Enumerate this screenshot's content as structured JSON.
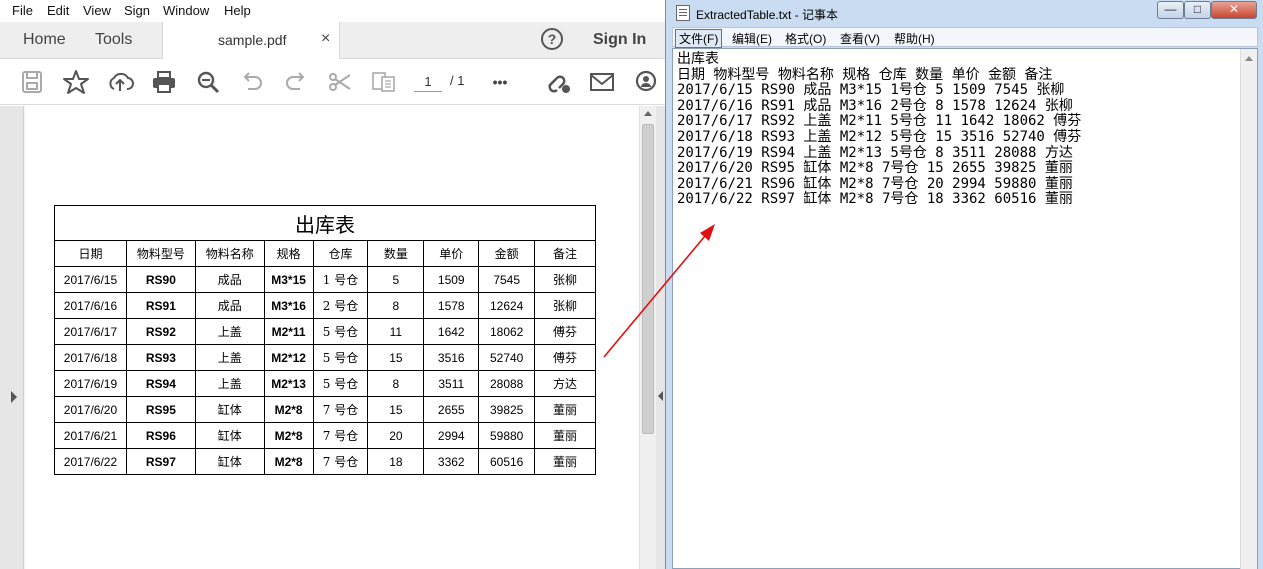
{
  "reader": {
    "menu": [
      "File",
      "Edit",
      "View",
      "Sign",
      "Window",
      "Help"
    ],
    "tabs": {
      "home": "Home",
      "tools": "Tools",
      "document": "sample.pdf",
      "close": "×"
    },
    "help": "?",
    "sign_in": "Sign In",
    "toolbar": {
      "icons": [
        "save-icon",
        "star-icon",
        "upload-icon",
        "print-icon",
        "zoom-icon",
        "undo-icon",
        "redo-icon",
        "scissors-icon",
        "compare-icon",
        "more-icon",
        "link-share-icon",
        "mail-icon",
        "add-user-icon"
      ],
      "page_current": "1",
      "page_total": "/ 1",
      "more": "•••"
    }
  },
  "pdf_table": {
    "title": "出库表",
    "headers": [
      "日期",
      "物料型号",
      "物料名称",
      "规格",
      "仓库",
      "数量",
      "单价",
      "金额",
      "备注"
    ],
    "rows": [
      [
        "2017/6/15",
        "RS90",
        "成品",
        "M3*15",
        "1 号仓",
        "5",
        "1509",
        "7545",
        "张柳"
      ],
      [
        "2017/6/16",
        "RS91",
        "成品",
        "M3*16",
        "2 号仓",
        "8",
        "1578",
        "12624",
        "张柳"
      ],
      [
        "2017/6/17",
        "RS92",
        "上盖",
        "M2*11",
        "5 号仓",
        "11",
        "1642",
        "18062",
        "傅芬"
      ],
      [
        "2017/6/18",
        "RS93",
        "上盖",
        "M2*12",
        "5 号仓",
        "15",
        "3516",
        "52740",
        "傅芬"
      ],
      [
        "2017/6/19",
        "RS94",
        "上盖",
        "M2*13",
        "5 号仓",
        "8",
        "3511",
        "28088",
        "方达"
      ],
      [
        "2017/6/20",
        "RS95",
        "缸体",
        "M2*8",
        "7 号仓",
        "15",
        "2655",
        "39825",
        "董丽"
      ],
      [
        "2017/6/21",
        "RS96",
        "缸体",
        "M2*8",
        "7 号仓",
        "20",
        "2994",
        "59880",
        "董丽"
      ],
      [
        "2017/6/22",
        "RS97",
        "缸体",
        "M2*8",
        "7 号仓",
        "18",
        "3362",
        "60516",
        "董丽"
      ]
    ]
  },
  "notepad": {
    "title": "ExtractedTable.txt - 记事本",
    "window_buttons": {
      "minimize": "—",
      "maximize": "□",
      "close": "✕"
    },
    "menu": [
      "文件(F)",
      "编辑(E)",
      "格式(O)",
      "查看(V)",
      "帮助(H)"
    ],
    "lines": [
      "出库表",
      "日期 物料型号 物料名称 规格 仓库 数量 单价 金额 备注",
      "2017/6/15 RS90 成品 M3*15 1号仓 5 1509 7545 张柳",
      "2017/6/16 RS91 成品 M3*16 2号仓 8 1578 12624 张柳",
      "2017/6/17 RS92 上盖 M2*11 5号仓 11 1642 18062 傅芬",
      "2017/6/18 RS93 上盖 M2*12 5号仓 15 3516 52740 傅芬",
      "2017/6/19 RS94 上盖 M2*13 5号仓 8 3511 28088 方达",
      "2017/6/20 RS95 缸体 M2*8 7号仓 15 2655 39825 董丽",
      "2017/6/21 RS96 缸体 M2*8 7号仓 20 2994 59880 董丽",
      "2017/6/22 RS97 缸体 M2*8 7号仓 18 3362 60516 董丽"
    ]
  },
  "colors": {
    "arrow": "#e01010",
    "notepad_frame": "#c9dcf1",
    "reader_chrome": "#eeeeee"
  }
}
